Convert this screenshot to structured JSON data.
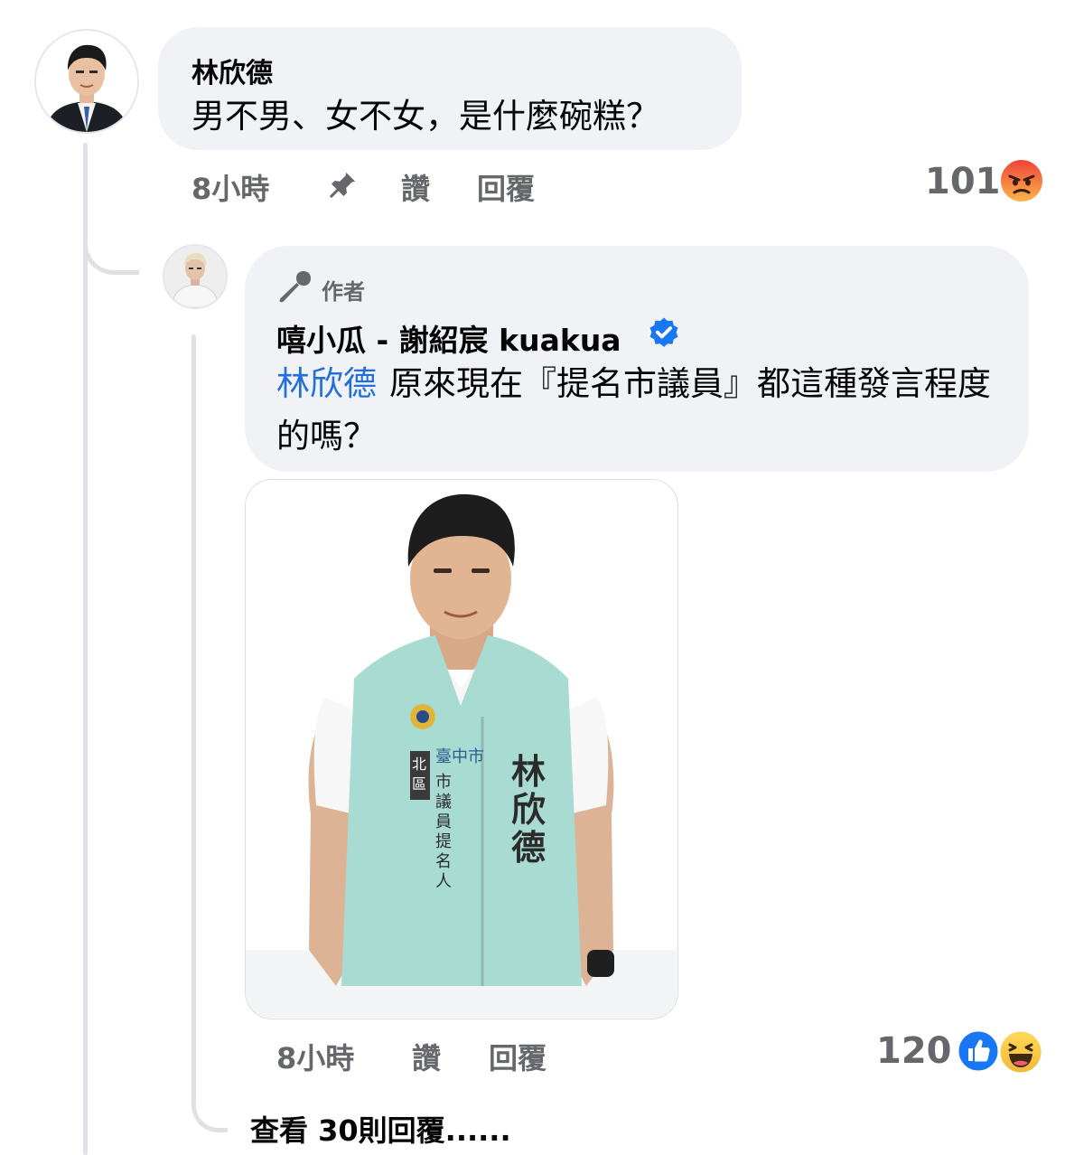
{
  "comment": {
    "author": "林欣德",
    "text": "男不男、女不女，是什麼碗糕？",
    "time": "8小時",
    "like_label": "讚",
    "reply_label": "回覆",
    "reaction_count": "101",
    "reaction_icon": "angry-reaction-icon"
  },
  "reply": {
    "badge": "作者",
    "author": "嘻小瓜 - 謝紹宸 kuakua",
    "verified": true,
    "mention": "林欣德",
    "text": "原來現在『提名市議員』都這種發言程度的嗎？",
    "photo": {
      "vest_line_1": "市議員提名人",
      "vest_district": "北區",
      "vest_city": "臺中市",
      "vest_name": "林欣德"
    },
    "time": "8小時",
    "like_label": "讚",
    "reply_label": "回覆",
    "reaction_count": "120",
    "reaction_icons": [
      "like-reaction-icon",
      "haha-reaction-icon"
    ]
  },
  "view_more": "查看 30則回覆......",
  "colors": {
    "bubble": "#f0f2f5",
    "meta": "#65676b",
    "mention": "#216fdb",
    "verified": "#1877f2",
    "angry": "#f4613b",
    "vest": "#a8dcd3"
  }
}
